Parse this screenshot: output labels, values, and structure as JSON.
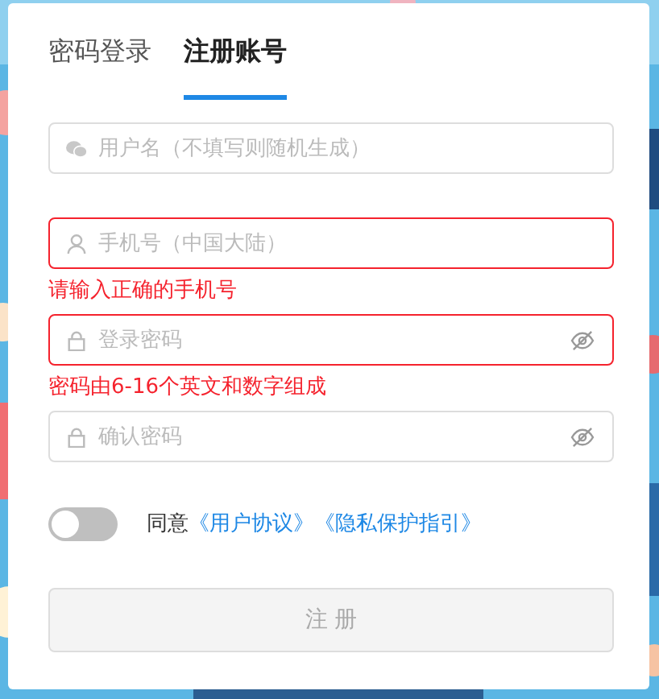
{
  "tabs": [
    {
      "label": "密码登录",
      "selected": false
    },
    {
      "label": "注册账号",
      "selected": true
    }
  ],
  "fields": [
    {
      "kind": "chat",
      "placeholder": "用户名（不填写则随机生成）",
      "invalid": false,
      "reveal_toggle": false
    },
    {
      "kind": "user",
      "placeholder": "手机号（中国大陆）",
      "invalid": true,
      "error": "请输入正确的手机号",
      "reveal_toggle": false
    },
    {
      "kind": "lock",
      "placeholder": "登录密码",
      "invalid": true,
      "error": "密码由6-16个英文和数字组成",
      "reveal_toggle": true
    },
    {
      "kind": "lock",
      "placeholder": "确认密码",
      "invalid": false,
      "reveal_toggle": true
    }
  ],
  "agreement": {
    "on": false,
    "text": "同意",
    "links": [
      "《用户协议》",
      "《隐私保护指引》"
    ]
  },
  "submit": {
    "label": "注 册",
    "disabled": true
  }
}
